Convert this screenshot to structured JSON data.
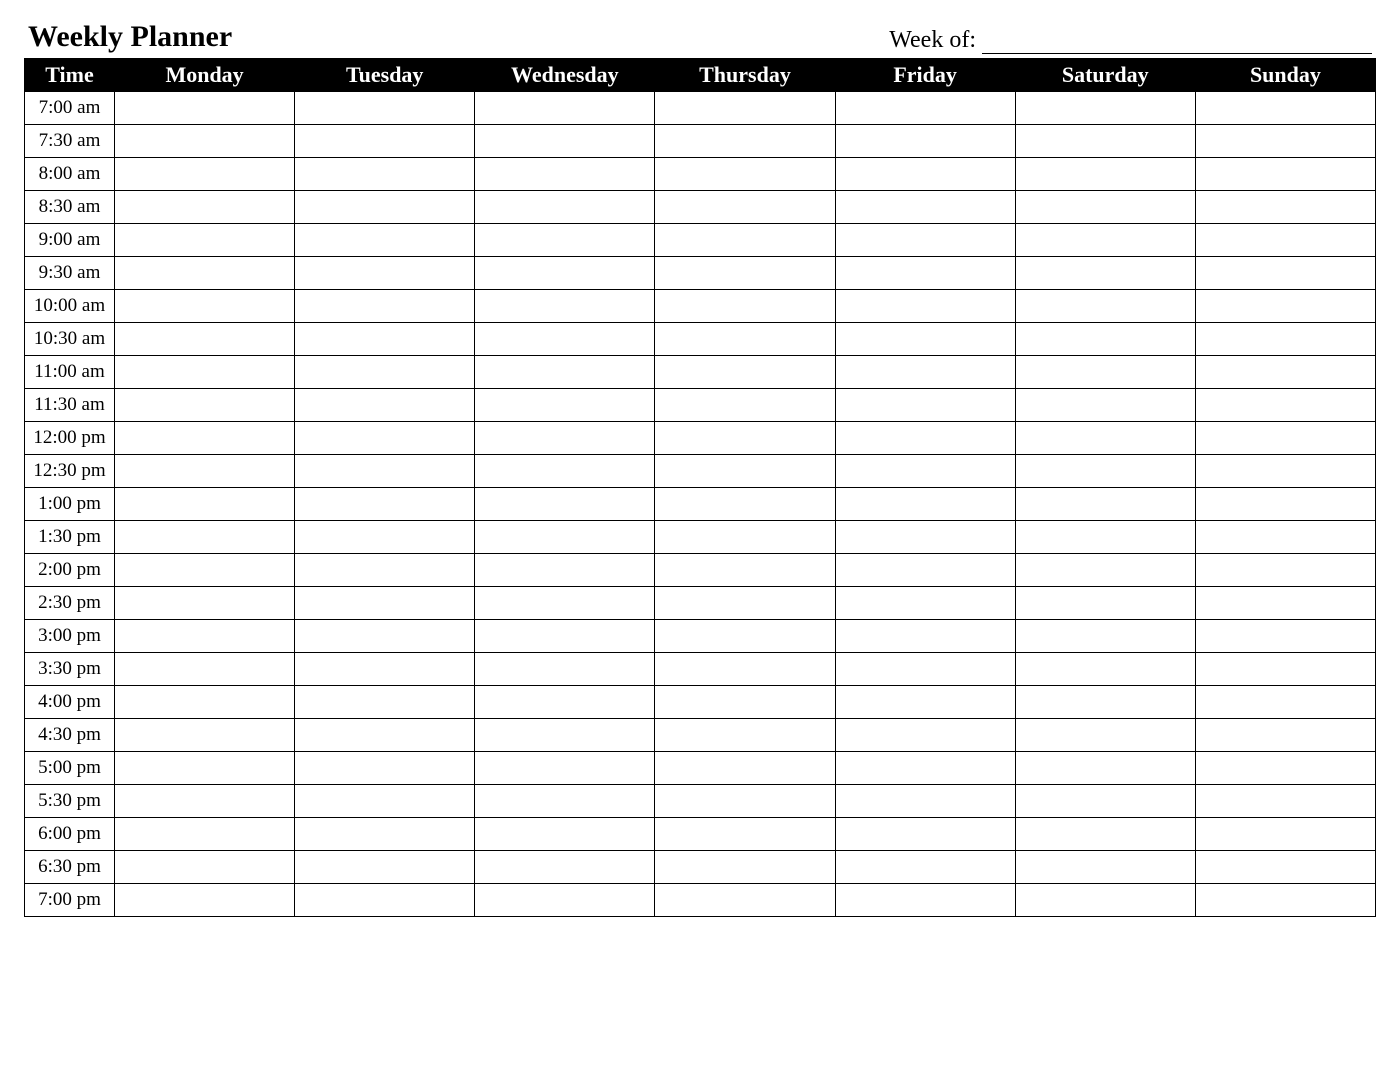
{
  "title": "Weekly Planner",
  "week_of_label": "Week of:",
  "week_of_value": "",
  "columns": {
    "time": "Time",
    "days": [
      "Monday",
      "Tuesday",
      "Wednesday",
      "Thursday",
      "Friday",
      "Saturday",
      "Sunday"
    ]
  },
  "rows": [
    {
      "time": "7:00 am",
      "entries": [
        "",
        "",
        "",
        "",
        "",
        "",
        ""
      ]
    },
    {
      "time": "7:30 am",
      "entries": [
        "",
        "",
        "",
        "",
        "",
        "",
        ""
      ]
    },
    {
      "time": "8:00 am",
      "entries": [
        "",
        "",
        "",
        "",
        "",
        "",
        ""
      ]
    },
    {
      "time": "8:30 am",
      "entries": [
        "",
        "",
        "",
        "",
        "",
        "",
        ""
      ]
    },
    {
      "time": "9:00 am",
      "entries": [
        "",
        "",
        "",
        "",
        "",
        "",
        ""
      ]
    },
    {
      "time": "9:30 am",
      "entries": [
        "",
        "",
        "",
        "",
        "",
        "",
        ""
      ]
    },
    {
      "time": "10:00 am",
      "entries": [
        "",
        "",
        "",
        "",
        "",
        "",
        ""
      ]
    },
    {
      "time": "10:30 am",
      "entries": [
        "",
        "",
        "",
        "",
        "",
        "",
        ""
      ]
    },
    {
      "time": "11:00 am",
      "entries": [
        "",
        "",
        "",
        "",
        "",
        "",
        ""
      ]
    },
    {
      "time": "11:30 am",
      "entries": [
        "",
        "",
        "",
        "",
        "",
        "",
        ""
      ]
    },
    {
      "time": "12:00 pm",
      "entries": [
        "",
        "",
        "",
        "",
        "",
        "",
        ""
      ]
    },
    {
      "time": "12:30 pm",
      "entries": [
        "",
        "",
        "",
        "",
        "",
        "",
        ""
      ]
    },
    {
      "time": "1:00 pm",
      "entries": [
        "",
        "",
        "",
        "",
        "",
        "",
        ""
      ]
    },
    {
      "time": "1:30 pm",
      "entries": [
        "",
        "",
        "",
        "",
        "",
        "",
        ""
      ]
    },
    {
      "time": "2:00 pm",
      "entries": [
        "",
        "",
        "",
        "",
        "",
        "",
        ""
      ]
    },
    {
      "time": "2:30 pm",
      "entries": [
        "",
        "",
        "",
        "",
        "",
        "",
        ""
      ]
    },
    {
      "time": "3:00 pm",
      "entries": [
        "",
        "",
        "",
        "",
        "",
        "",
        ""
      ]
    },
    {
      "time": "3:30 pm",
      "entries": [
        "",
        "",
        "",
        "",
        "",
        "",
        ""
      ]
    },
    {
      "time": "4:00 pm",
      "entries": [
        "",
        "",
        "",
        "",
        "",
        "",
        ""
      ]
    },
    {
      "time": "4:30 pm",
      "entries": [
        "",
        "",
        "",
        "",
        "",
        "",
        ""
      ]
    },
    {
      "time": "5:00 pm",
      "entries": [
        "",
        "",
        "",
        "",
        "",
        "",
        ""
      ]
    },
    {
      "time": "5:30 pm",
      "entries": [
        "",
        "",
        "",
        "",
        "",
        "",
        ""
      ]
    },
    {
      "time": "6:00 pm",
      "entries": [
        "",
        "",
        "",
        "",
        "",
        "",
        ""
      ]
    },
    {
      "time": "6:30 pm",
      "entries": [
        "",
        "",
        "",
        "",
        "",
        "",
        ""
      ]
    },
    {
      "time": "7:00 pm",
      "entries": [
        "",
        "",
        "",
        "",
        "",
        "",
        ""
      ]
    }
  ]
}
